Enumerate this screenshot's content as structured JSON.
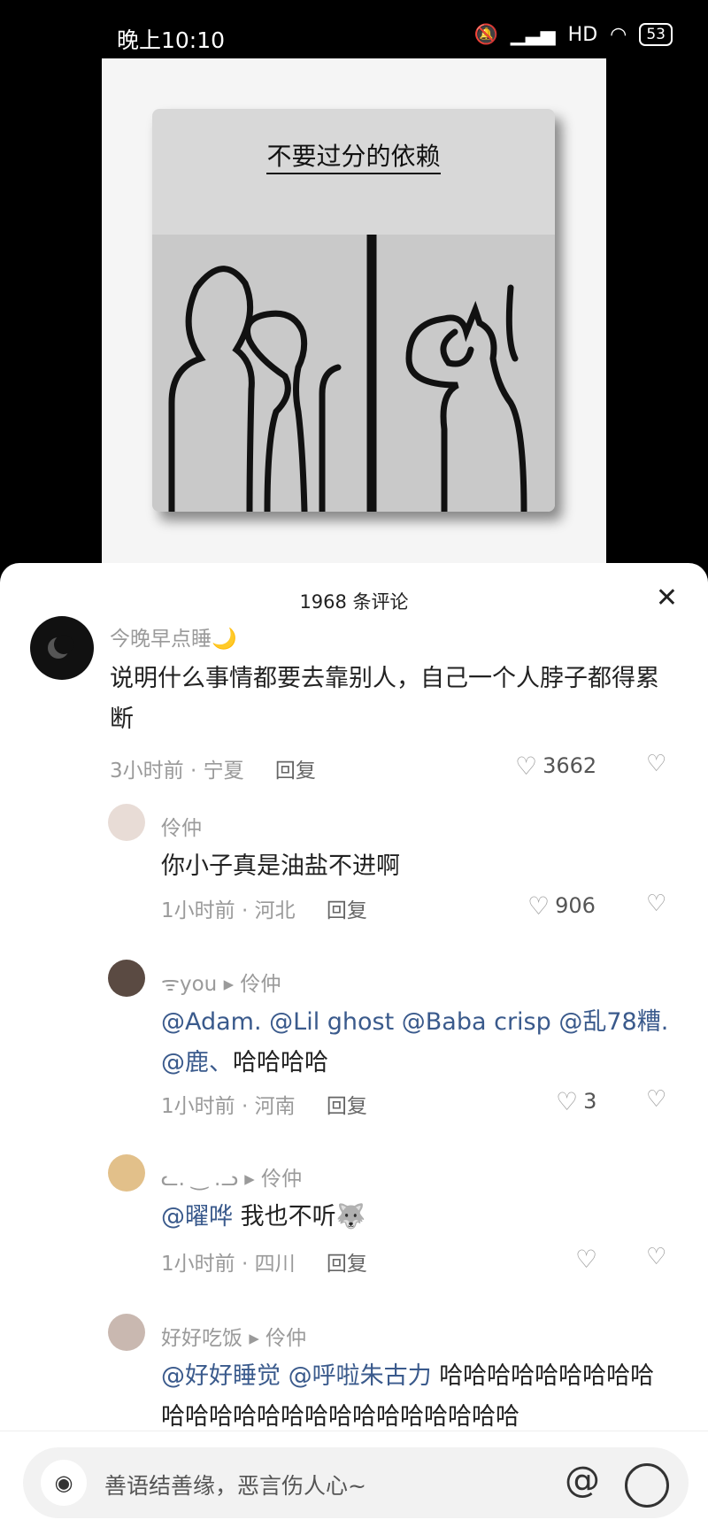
{
  "status_bar": {
    "time": "晚上10:10",
    "signal": "HD",
    "battery": "53"
  },
  "post": {
    "image_title": "不要过分的依赖"
  },
  "comments_header": {
    "count_text": "1968 条评论",
    "close": "✕"
  },
  "comments": [
    {
      "user": "今晚早点睡🌙",
      "text": "说明什么事情都要去靠别人，自己一个人脖子都得累断",
      "time": "3小时前",
      "sep": "·",
      "location": "宁夏",
      "reply": "回复",
      "likes": "3662"
    },
    {
      "user": "伶仲",
      "text": "你小子真是油盐不进啊",
      "time": "1小时前",
      "sep": "·",
      "location": "河北",
      "reply": "回复",
      "likes": "906"
    },
    {
      "user": "ᯤyou",
      "reply_to": "伶仲",
      "mentions": [
        "@Adam. @Lil  ghost @Baba crisp @乱78糟. @鹿、"
      ],
      "text": "哈哈哈哈",
      "time": "1小时前",
      "sep": "·",
      "location": "河南",
      "reply": "回复",
      "likes": "3"
    },
    {
      "user": "ᓚ. ‿ .ᓗ",
      "reply_to": "伶仲",
      "mentions": [
        "@曜哗"
      ],
      "text": "我也不听🐺",
      "time": "1小时前",
      "sep": "·",
      "location": "四川",
      "reply": "回复",
      "likes": ""
    },
    {
      "user": "好好吃饭",
      "reply_to": "伶仲",
      "mentions": [
        "@好好睡觉 @呼啦朱古力"
      ],
      "text": "哈哈哈哈哈哈哈哈哈哈哈哈哈哈哈哈哈哈哈哈哈哈哈哈"
    }
  ],
  "input": {
    "placeholder": "善语结善缘，恶言伤人心~",
    "at": "@"
  },
  "icons": {
    "heart": "heart-icon",
    "dislike": "broken-heart-icon",
    "camera": "camera-icon"
  }
}
